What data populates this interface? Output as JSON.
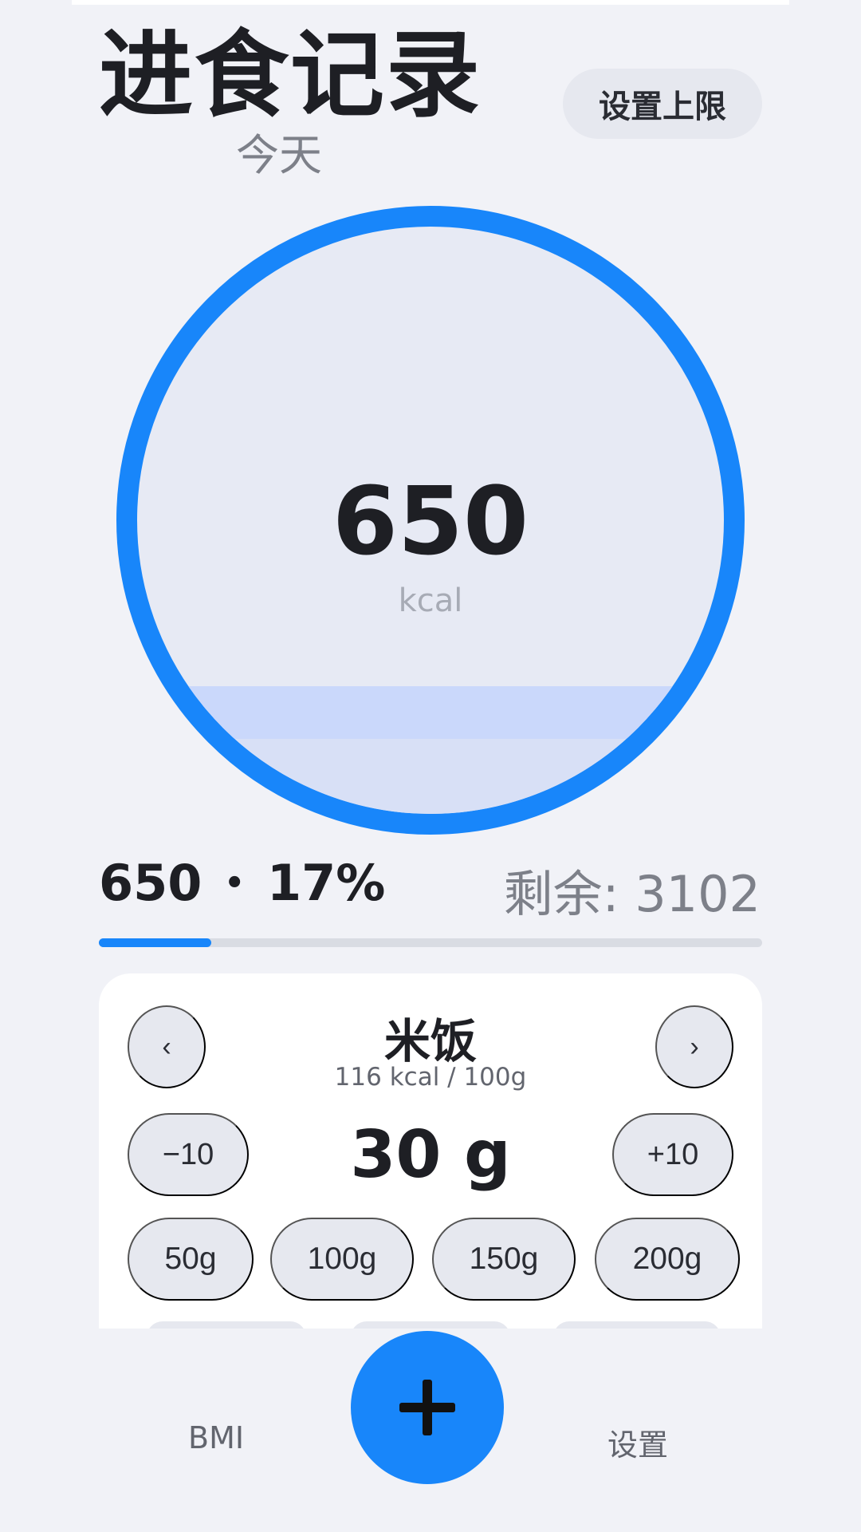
{
  "header": {
    "title": "进食记录",
    "subtitle": "今天",
    "limit_button": "设置上限"
  },
  "summary": {
    "consumed": "650",
    "unit": "kcal",
    "percent": "17%",
    "remaining_label": "剩余:",
    "remaining": "3102",
    "progress_fraction": 0.17,
    "accent_color": "#1886FA"
  },
  "food": {
    "prev": "‹",
    "next": "›",
    "name": "米饭",
    "calories": "116 kcal / 100g",
    "minus": "−10",
    "amount": "30 g",
    "plus": "+10",
    "presets": [
      "50g",
      "100g",
      "150g",
      "200g"
    ]
  },
  "tabs": {
    "bmi": "BMI",
    "settings": "设置"
  }
}
